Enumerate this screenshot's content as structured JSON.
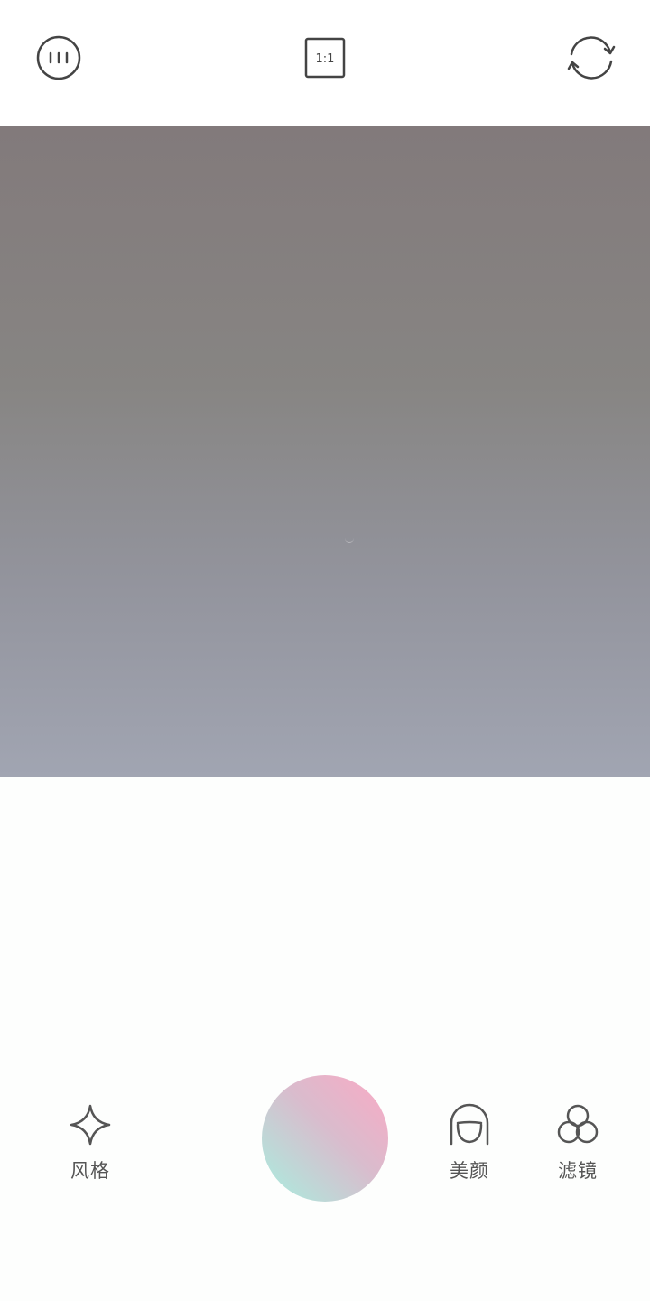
{
  "top_bar": {
    "menu_icon": "menu-circle-icon",
    "aspect_ratio_label": "1:1",
    "switch_camera_icon": "switch-camera-icon"
  },
  "viewfinder": {
    "colors": {
      "top": "#827a7b",
      "bottom": "#a1a5b2"
    }
  },
  "bottom": {
    "tools": [
      {
        "id": "style",
        "label": "风格",
        "icon": "sparkle-icon"
      },
      {
        "id": "beauty",
        "label": "美颜",
        "icon": "face-icon"
      },
      {
        "id": "filter",
        "label": "滤镜",
        "icon": "filter-circles-icon"
      }
    ],
    "shutter": {
      "icon": "shutter-button",
      "colors": [
        "#fba9c4",
        "#a8efdf"
      ]
    }
  }
}
